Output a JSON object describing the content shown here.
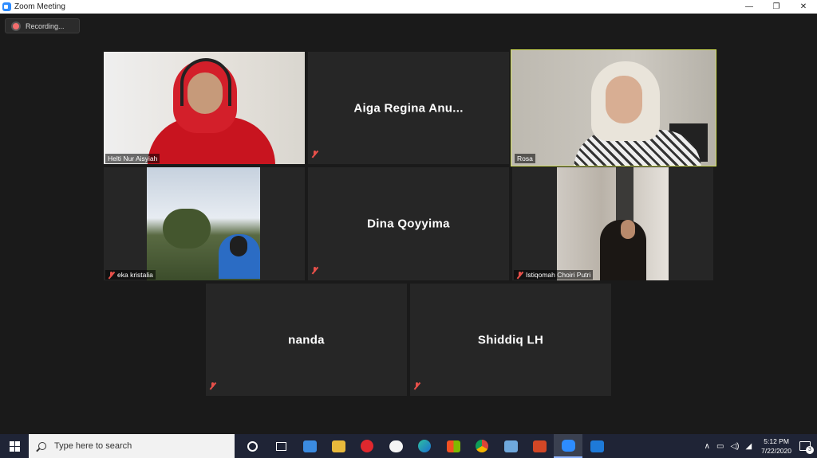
{
  "window": {
    "title": "Zoom Meeting",
    "controls": {
      "minimize": "—",
      "restore": "❐",
      "close": "✕"
    }
  },
  "recording": {
    "label": "Recording..."
  },
  "participants": [
    {
      "name": "Helti Nur Aisyiah",
      "video": true,
      "muted": false,
      "active": false
    },
    {
      "name": "Aiga Regina Anu...",
      "video": false,
      "muted": true,
      "active": false
    },
    {
      "name": "Rosa",
      "video": true,
      "muted": false,
      "active": true
    },
    {
      "name": "eka kristalia",
      "video": true,
      "muted": true,
      "active": false
    },
    {
      "name": "Dina Qoyyima",
      "video": false,
      "muted": true,
      "active": false
    },
    {
      "name": "Istiqomah Choiri Putri",
      "video": true,
      "muted": true,
      "active": false
    },
    {
      "name": "nanda",
      "video": false,
      "muted": true,
      "active": false
    },
    {
      "name": "Shiddiq LH",
      "video": false,
      "muted": true,
      "active": false
    }
  ],
  "colors": {
    "active_speaker": "#d4e157",
    "muted_icon": "#e8504a",
    "tile_bg": "#262626",
    "taskbar": "#1f2436"
  },
  "taskbar": {
    "search_placeholder": "Type here to search",
    "apps": [
      "cortana",
      "task-view",
      "mail",
      "file-explorer",
      "opera",
      "onedrive",
      "edge",
      "store",
      "chrome",
      "screen-sketch",
      "powerpoint",
      "zoom",
      "media-player"
    ],
    "tray": {
      "chevron": "∧",
      "time": "5:12 PM",
      "date": "7/22/2020",
      "notifications": "3"
    }
  }
}
